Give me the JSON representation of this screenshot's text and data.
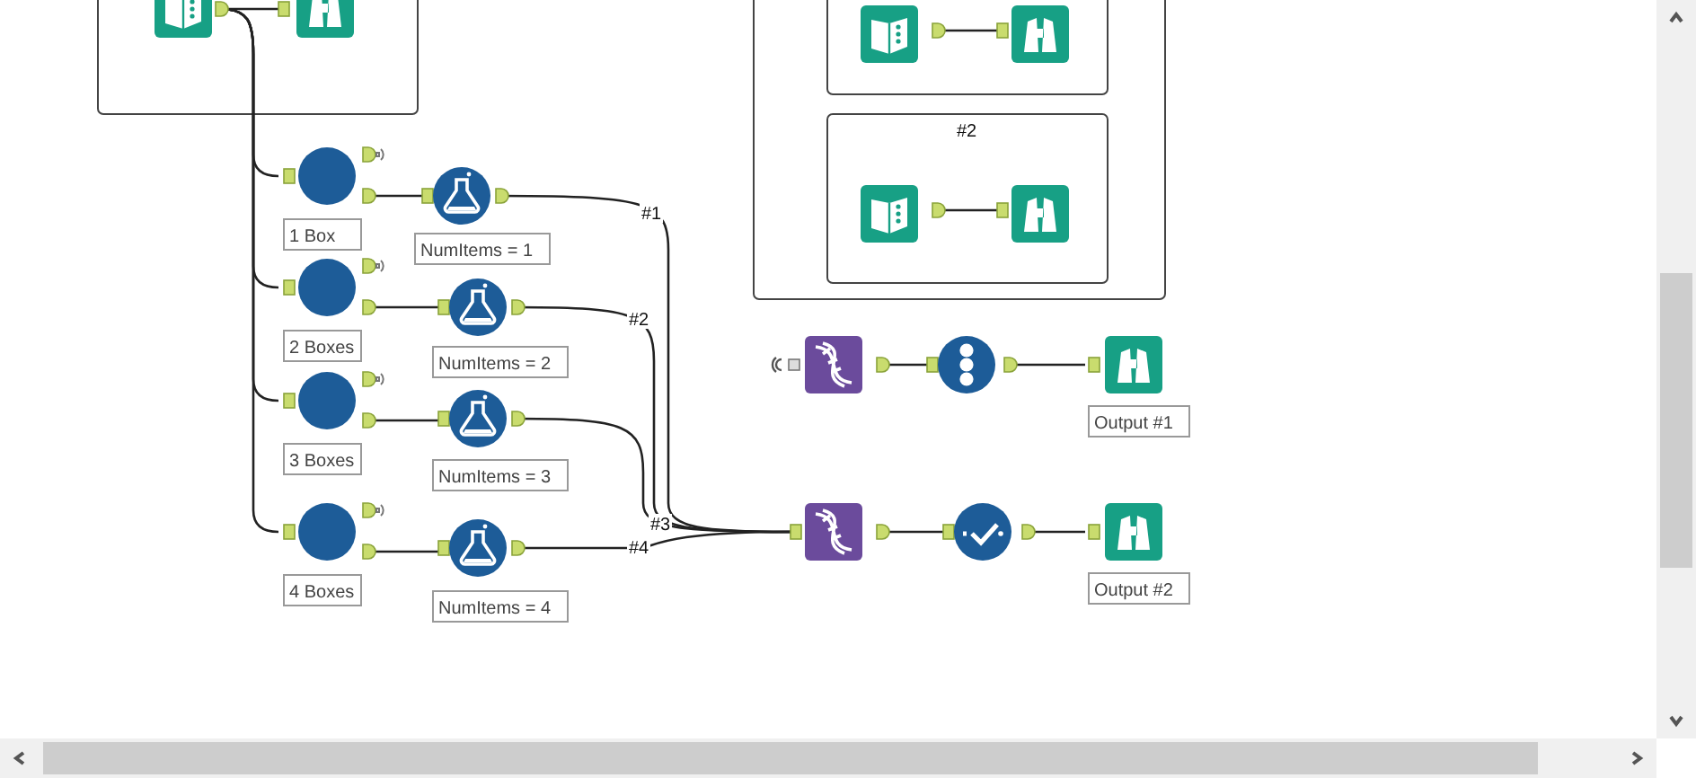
{
  "container_title": "#2",
  "boxes": [
    {
      "label": "1 Box"
    },
    {
      "label": "2 Boxes"
    },
    {
      "label": "3 Boxes"
    },
    {
      "label": "4 Boxes"
    }
  ],
  "formulas": [
    {
      "label": "NumItems = 1",
      "connection": "#1"
    },
    {
      "label": "NumItems = 2",
      "connection": "#2"
    },
    {
      "label": "NumItems = 3",
      "connection": "#3"
    },
    {
      "label": "NumItems = 4",
      "connection": "#4"
    }
  ],
  "outputs": [
    {
      "label": "Output #1"
    },
    {
      "label": "Output #2"
    }
  ]
}
